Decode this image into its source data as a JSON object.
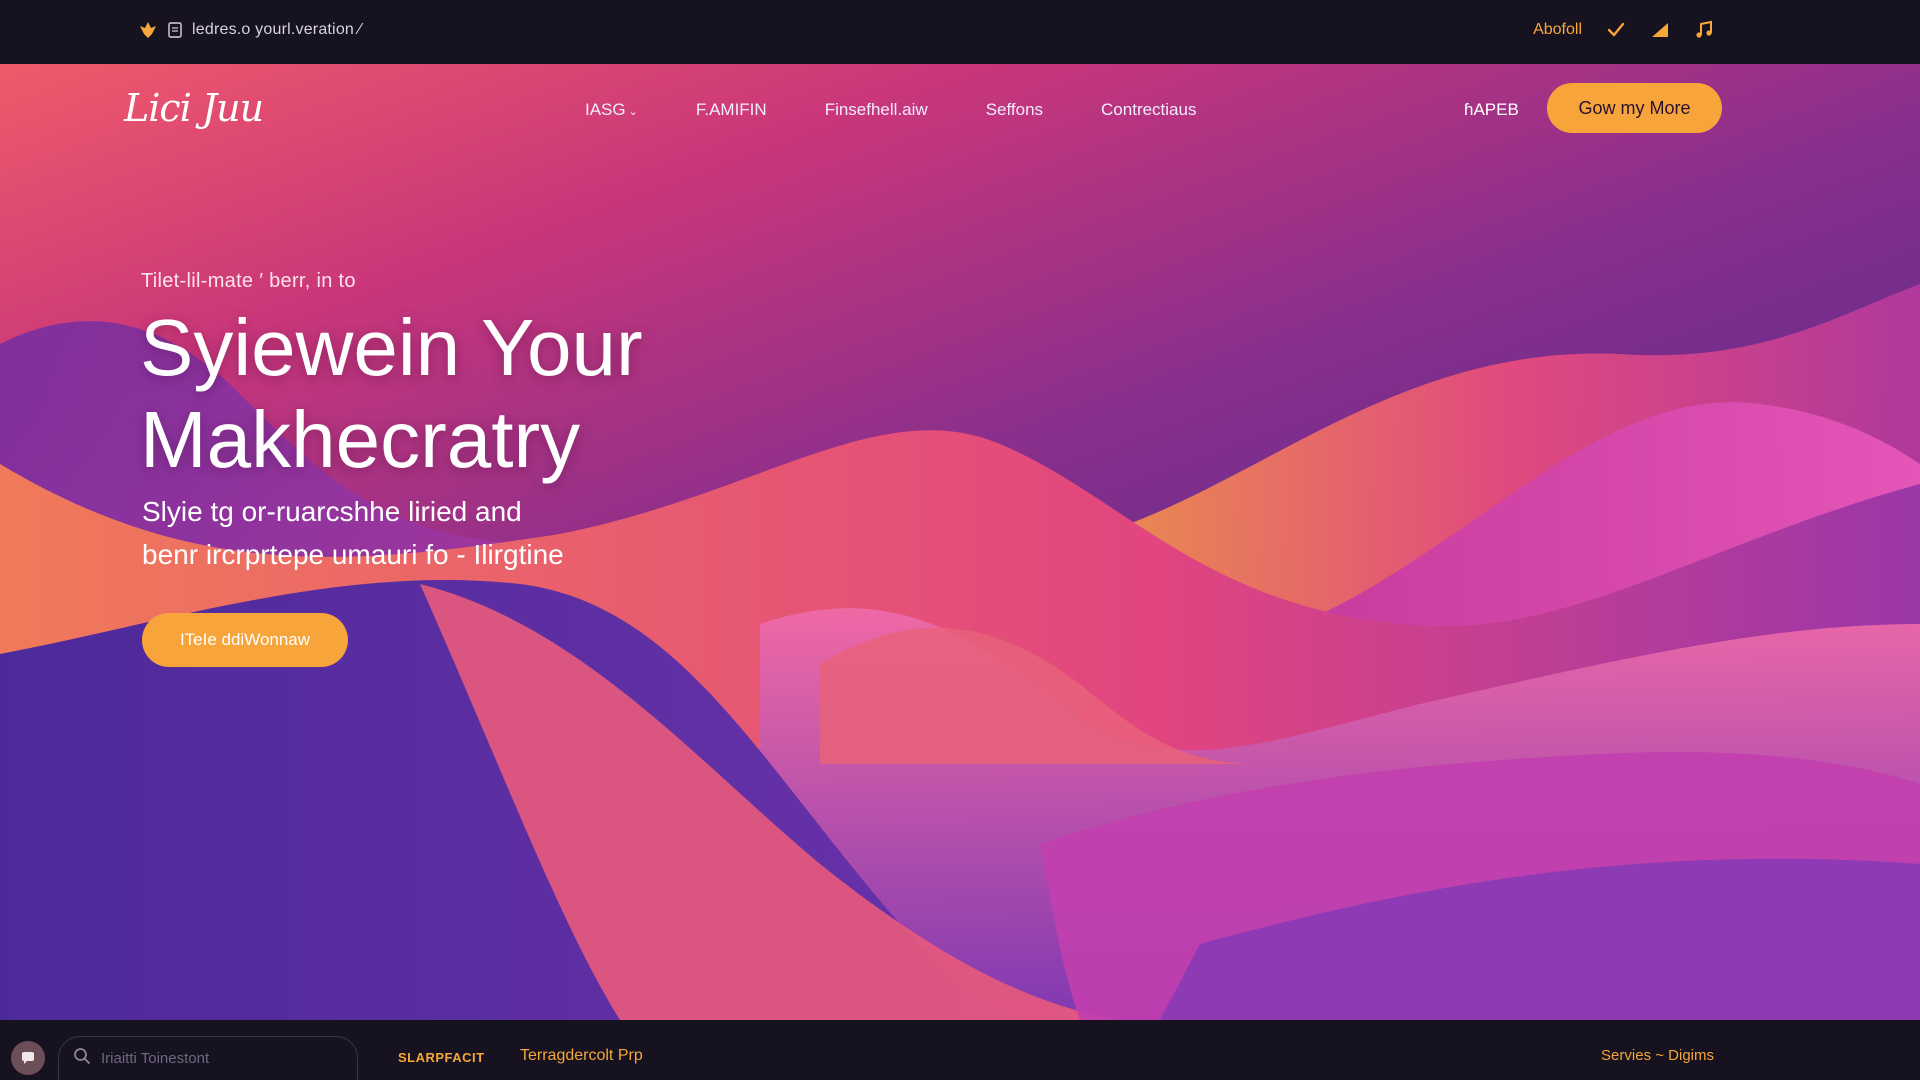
{
  "topbar": {
    "url_text": "ledres.o yourl.veration ⁄",
    "about_label": "Abofoll",
    "icons": [
      "flame-logo-icon",
      "document-icon",
      "check-icon",
      "signal-icon",
      "music-note-icon"
    ]
  },
  "nav": {
    "brand": "Lici Juu",
    "menu": [
      "IASG",
      "F.AMIFIN",
      "Finsefhell.aiw",
      "Seffons",
      "Contrectiaus"
    ],
    "link_label": "ɦAPEB",
    "cta_label": "Gow my More"
  },
  "hero": {
    "eyebrow": "Tilet-lil-mate ′ berr, in to",
    "headline_line1": "Syiewein Your",
    "headline_line2": "Makhecratry",
    "subline_line1": "Slyie tg or-ruarcshhe liried and",
    "subline_line2": "benr ircrprtepe umauri fo - Ilirgtine",
    "cta_label": "ITeIe ddiWonnaw"
  },
  "bottombar": {
    "search_placeholder": "Iriaitti Toinestont",
    "link1": "SLARPFACIT",
    "link2": "Terragdercolt Prp",
    "right_text": "Servies ~ Digims"
  },
  "colors": {
    "accent": "#f7a43a",
    "bar_background": "#16121f",
    "gradient_pink": "#ef5a6a",
    "gradient_purple": "#3b2379"
  }
}
